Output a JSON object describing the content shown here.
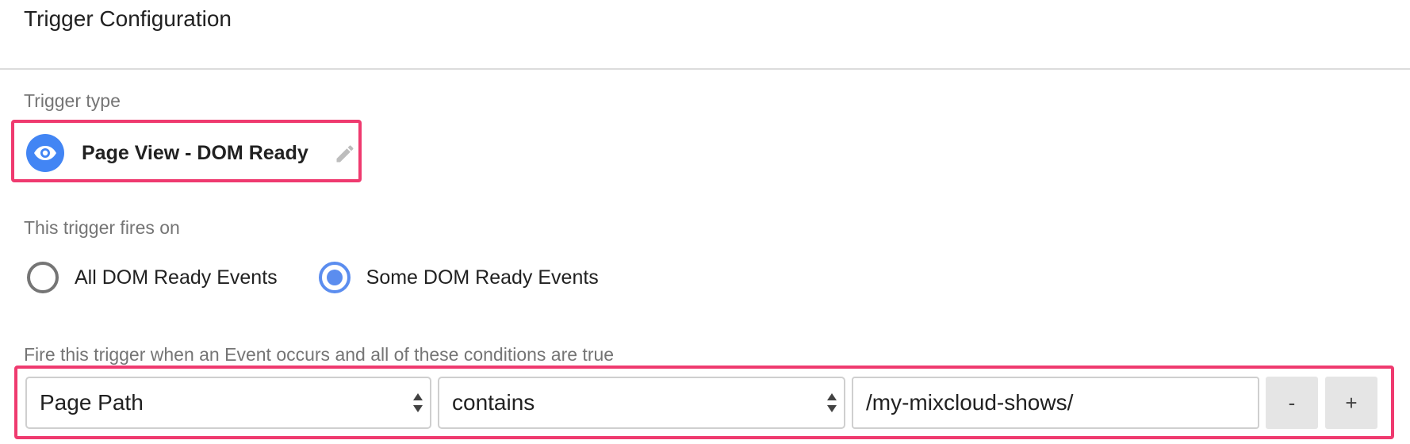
{
  "header": {
    "title": "Trigger Configuration"
  },
  "trigger_type": {
    "label": "Trigger type",
    "name": "Page View - DOM Ready",
    "icon": "eye-icon",
    "edit_icon": "pencil-icon",
    "accent_color": "#4285f4"
  },
  "fires_on": {
    "label": "This trigger fires on",
    "options": [
      {
        "label": "All DOM Ready Events",
        "selected": false
      },
      {
        "label": "Some DOM Ready Events",
        "selected": true
      }
    ]
  },
  "conditions": {
    "label": "Fire this trigger when an Event occurs and all of these conditions are true",
    "variable": "Page Path",
    "operator": "contains",
    "value": "/my-mixcloud-shows/",
    "remove_label": "-",
    "add_label": "+"
  },
  "highlight_color": "#ef3a6f"
}
